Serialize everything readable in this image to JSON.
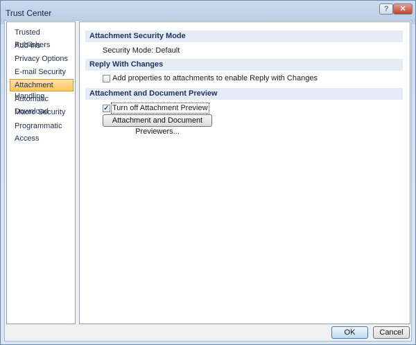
{
  "window": {
    "title": "Trust Center",
    "help_label": "?",
    "close_label": "✕"
  },
  "sidebar": {
    "items": [
      {
        "label": "Trusted Publishers",
        "selected": false
      },
      {
        "label": "Add-ins",
        "selected": false
      },
      {
        "label": "Privacy Options",
        "selected": false
      },
      {
        "label": "E-mail Security",
        "selected": false
      },
      {
        "label": "Attachment Handling",
        "selected": true
      },
      {
        "label": "Automatic Download",
        "selected": false
      },
      {
        "label": "Macro Security",
        "selected": false
      },
      {
        "label": "Programmatic Access",
        "selected": false
      }
    ]
  },
  "main": {
    "attachment_security": {
      "header": "Attachment Security Mode",
      "mode_text": "Security Mode: Default"
    },
    "reply_with_changes": {
      "header": "Reply With Changes",
      "checkbox_label": "Add properties to attachments to enable Reply with Changes",
      "checked": false
    },
    "preview": {
      "header": "Attachment and Document Preview",
      "checkbox_label": "Turn off Attachment Preview",
      "checked": true,
      "button_label": "Attachment and Document Previewers..."
    }
  },
  "footer": {
    "ok_label": "OK",
    "cancel_label": "Cancel"
  }
}
